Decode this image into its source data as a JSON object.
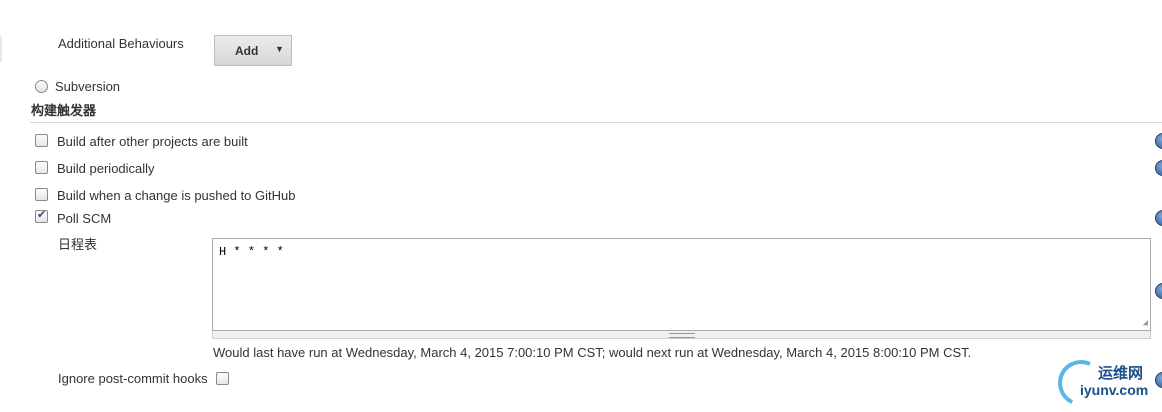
{
  "scm": {
    "additional_behaviours_label": "Additional Behaviours",
    "add_button_label": "Add",
    "subversion_label": "Subversion"
  },
  "triggers": {
    "section_title": "构建触发器",
    "items": [
      {
        "label": "Build after other projects are built",
        "checked": false
      },
      {
        "label": "Build periodically",
        "checked": false
      },
      {
        "label": "Build when a change is pushed to GitHub",
        "checked": false
      },
      {
        "label": "Poll SCM",
        "checked": true
      }
    ],
    "schedule_label": "日程表",
    "schedule_value": "H * * * *",
    "schedule_message": "Would last have run at Wednesday, March 4, 2015 7:00:10 PM CST; would next run at Wednesday, March 4, 2015 8:00:10 PM CST.",
    "ignore_hooks_label": "Ignore post-commit hooks"
  },
  "watermark": {
    "name_cn": "运维网",
    "name_en": "iyunv.com"
  }
}
